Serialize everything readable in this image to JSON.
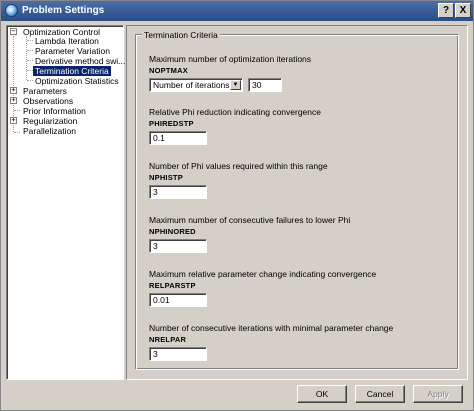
{
  "window": {
    "title": "Problem Settings",
    "help_label": "?",
    "close_label": "X"
  },
  "tree": {
    "items": [
      {
        "label": "Optimization Control",
        "expander": "−"
      },
      {
        "label": "Lambda Iteration"
      },
      {
        "label": "Parameter Variation"
      },
      {
        "label": "Derivative method swi..."
      },
      {
        "label": "Termination Criteria",
        "selected": true
      },
      {
        "label": "Optimization Statistics"
      },
      {
        "label": "Parameters",
        "expander": "+"
      },
      {
        "label": "Observations",
        "expander": "+"
      },
      {
        "label": "Prior Information"
      },
      {
        "label": "Regularization",
        "expander": "+"
      },
      {
        "label": "Parallelization"
      }
    ]
  },
  "group": {
    "title": "Termination Criteria"
  },
  "params": [
    {
      "description": "Maximum number of optimization iterations",
      "name": "NOPTMAX",
      "value": "30",
      "mode": "Number of iterations"
    },
    {
      "description": "Relative Phi reduction indicating convergence",
      "name": "PHIREDSTP",
      "value": "0.1"
    },
    {
      "description": "Number of Phi values required within this range",
      "name": "NPHISTP",
      "value": "3"
    },
    {
      "description": "Maximum number of consecutive failures to lower Phi",
      "name": "NPHINORED",
      "value": "3"
    },
    {
      "description": "Maximum relative parameter change indicating convergence",
      "name": "RELPARSTP",
      "value": "0.01"
    },
    {
      "description": "Number of consecutive iterations with minimal parameter change",
      "name": "NRELPAR",
      "value": "3"
    }
  ],
  "buttons": {
    "ok": "OK",
    "cancel": "Cancel",
    "apply": "Apply"
  },
  "colors": {
    "titlebar": "#2b4d86",
    "selection": "#0a246a",
    "face": "#d4d0c8"
  }
}
